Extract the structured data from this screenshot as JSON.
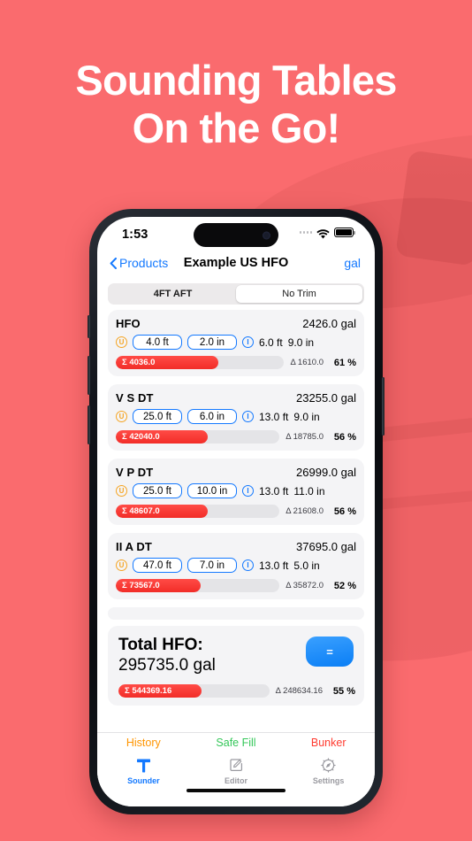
{
  "marketing": {
    "headline_line1": "Sounding Tables",
    "headline_line2": "On the Go!",
    "background_color": "#fa6b6e"
  },
  "status_bar": {
    "time": "1:53",
    "cellular_icon": "cellular-dots-icon",
    "wifi_icon": "wifi-icon",
    "battery_icon": "battery-full-icon"
  },
  "nav_bar": {
    "back_label": "Products",
    "back_icon": "chevron-left-icon",
    "title": "Example US HFO",
    "unit_label": "gal",
    "accent_color": "#1479ff"
  },
  "segmented": {
    "options": [
      {
        "label": "4FT AFT",
        "selected": false
      },
      {
        "label": "No Trim",
        "selected": true
      }
    ]
  },
  "tanks": [
    {
      "name": "HFO",
      "volume": "2426.0 gal",
      "ullage_icon": "ullage-u-icon",
      "sounding_ft": "4.0 ft",
      "sounding_in": "2.0 in",
      "info_icon": "info-i-icon",
      "ullage_ft": "6.0 ft",
      "ullage_in": "9.0 in",
      "bar_sum": "Σ 4036.0",
      "bar_delta": "Δ 1610.0",
      "bar_pct": "61 %",
      "fill_percent": 61
    },
    {
      "name": "V S DT",
      "volume": "23255.0 gal",
      "ullage_icon": "ullage-u-icon",
      "sounding_ft": "25.0 ft",
      "sounding_in": "6.0 in",
      "info_icon": "info-i-icon",
      "ullage_ft": "13.0 ft",
      "ullage_in": "9.0 in",
      "bar_sum": "Σ 42040.0",
      "bar_delta": "Δ 18785.0",
      "bar_pct": "56 %",
      "fill_percent": 56
    },
    {
      "name": "V P DT",
      "volume": "26999.0 gal",
      "ullage_icon": "ullage-u-icon",
      "sounding_ft": "25.0 ft",
      "sounding_in": "10.0 in",
      "info_icon": "info-i-icon",
      "ullage_ft": "13.0 ft",
      "ullage_in": "11.0 in",
      "bar_sum": "Σ 48607.0",
      "bar_delta": "Δ 21608.0",
      "bar_pct": "56 %",
      "fill_percent": 56
    },
    {
      "name": "II A DT",
      "volume": "37695.0 gal",
      "ullage_icon": "ullage-u-icon",
      "sounding_ft": "47.0 ft",
      "sounding_in": "7.0 in",
      "info_icon": "info-i-icon",
      "ullage_ft": "13.0 ft",
      "ullage_in": "5.0 in",
      "bar_sum": "Σ 73567.0",
      "bar_delta": "Δ 35872.0",
      "bar_pct": "52 %",
      "fill_percent": 52
    }
  ],
  "total": {
    "label": "Total HFO:",
    "value": "295735.0 gal",
    "equals_button_label": "=",
    "bar_sum": "Σ 544369.16",
    "bar_delta": "Δ 248634.16",
    "bar_pct": "55 %",
    "fill_percent": 55
  },
  "quick_links": [
    {
      "label": "History",
      "color": "#ff9500"
    },
    {
      "label": "Safe Fill",
      "color": "#34c759"
    },
    {
      "label": "Bunker",
      "color": "#ff3b30"
    }
  ],
  "tab_bar": [
    {
      "label": "Sounder",
      "icon": "sounder-t-icon",
      "selected": true
    },
    {
      "label": "Editor",
      "icon": "editor-pencil-square-icon",
      "selected": false
    },
    {
      "label": "Settings",
      "icon": "settings-gear-icon",
      "selected": false
    }
  ]
}
